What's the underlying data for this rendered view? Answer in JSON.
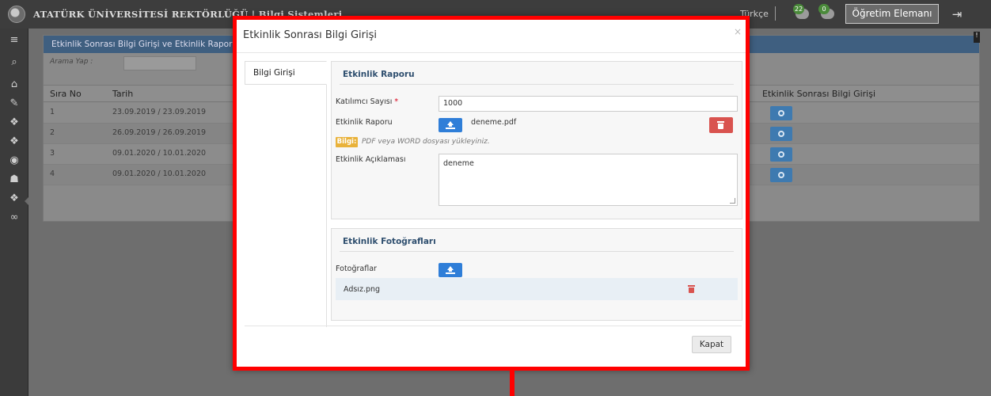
{
  "header": {
    "app_title": "ATATÜRK ÜNİVERSİTESİ REKTÖRLÜĞÜ | Bilgi Sistemleri",
    "language": "Türkçe",
    "notifications_count": "22",
    "messages_count": "0",
    "role_button": "Öğretim Elemanı"
  },
  "background": {
    "panel_title": "Etkinlik Sonrası Bilgi Girişi ve Etkinlik Raporu Alma",
    "search_label": "Arama Yap :",
    "columns": [
      "Sıra No",
      "Tarih",
      "Etkinlik Sonrası Bilgi Girişi"
    ],
    "rows": [
      {
        "no": "1",
        "date": "23.09.2019 / 23.09.2019"
      },
      {
        "no": "2",
        "date": "26.09.2019 / 26.09.2019"
      },
      {
        "no": "3",
        "date": "09.01.2020 / 10.01.2020"
      },
      {
        "no": "4",
        "date": "09.01.2020 / 10.01.2020"
      }
    ]
  },
  "modal": {
    "title": "Etkinlik Sonrası Bilgi Girişi",
    "close_symbol": "×",
    "tab_label": "Bilgi Girişi",
    "report_section": {
      "title": "Etkinlik Raporu",
      "participants_label": "Katılımcı Sayısı",
      "required_mark": "*",
      "participants_value": "1000",
      "report_label": "Etkinlik Raporu",
      "report_file": "deneme.pdf",
      "info_badge": "Bilgi:",
      "info_text": "PDF veya WORD dosyası yükleyiniz.",
      "description_label": "Etkinlik Açıklaması",
      "description_value": "deneme"
    },
    "photos_section": {
      "title": "Etkinlik Fotoğrafları",
      "photos_label": "Fotoğraflar",
      "files": [
        "Adsız.png"
      ]
    },
    "close_button": "Kapat"
  },
  "colors": {
    "accent": "#2f7ed8",
    "danger": "#d9534f",
    "highlight_border": "#ff0000",
    "info_badge": "#e9b23a"
  }
}
